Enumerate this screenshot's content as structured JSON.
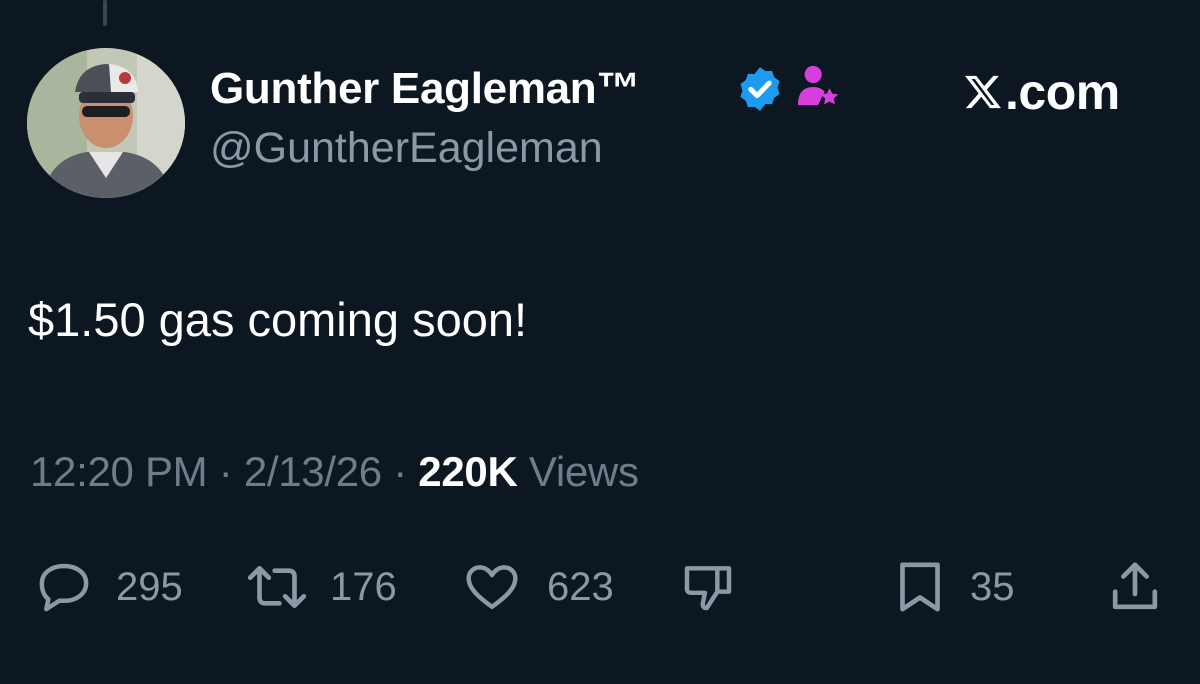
{
  "author": {
    "display_name": "Gunther Eagleman™",
    "handle": "@GuntherEagleman",
    "verified_icon": "verified-badge-icon",
    "affiliate_icon": "affiliate-person-star-icon"
  },
  "brand": {
    "text": ".com",
    "logo_icon": "x-logo-icon"
  },
  "tweet": {
    "text": "$1.50 gas coming soon!"
  },
  "meta": {
    "time": "12:20 PM",
    "separator": "·",
    "date": "2/13/26",
    "views_count": "220K",
    "views_label": "Views"
  },
  "actions": {
    "replies": "295",
    "reposts": "176",
    "likes": "623",
    "bookmarks": "35"
  },
  "colors": {
    "background": "#0c1722",
    "verified": "#1d9bf0",
    "affiliate": "#d63ee0",
    "muted": "#8b98a5"
  }
}
